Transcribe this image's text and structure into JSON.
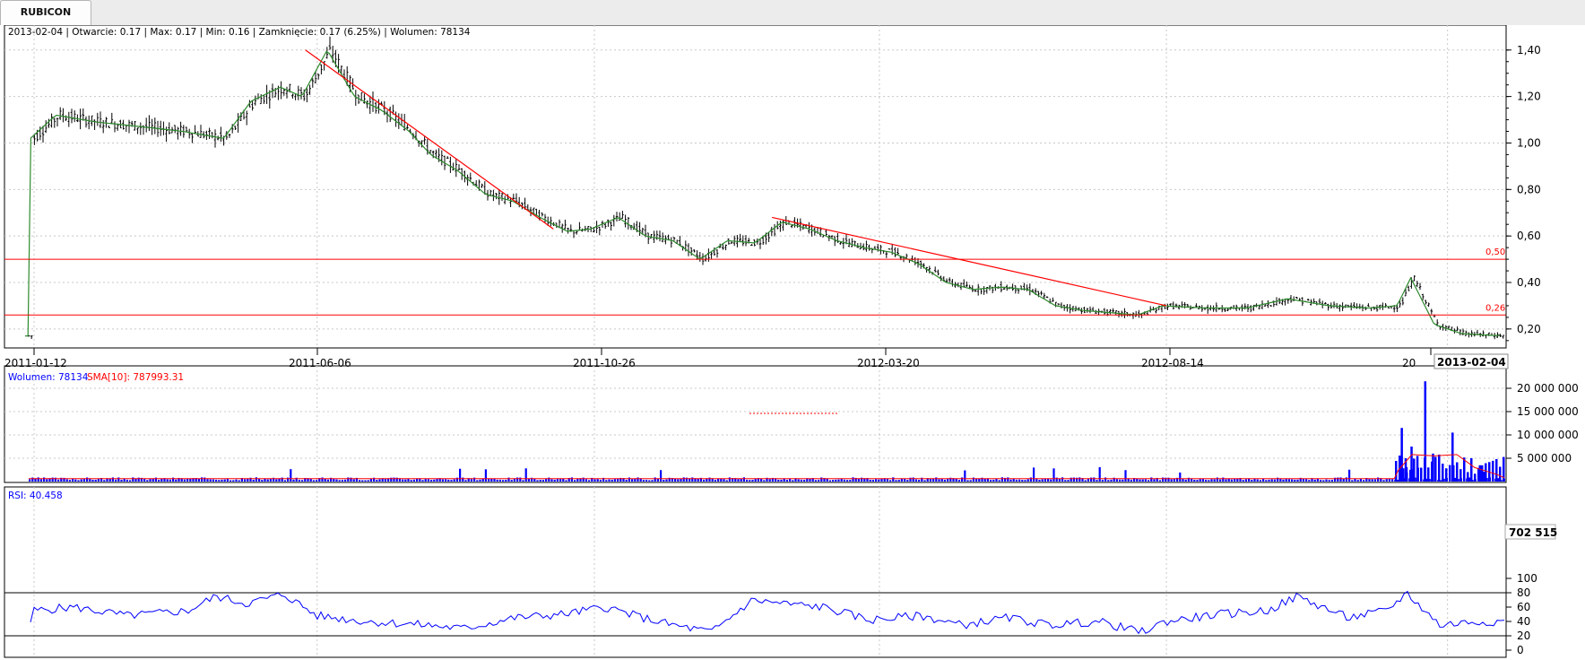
{
  "tab": {
    "label": "RUBICON"
  },
  "price_info": "2013-02-04 | Otwarcie: 0.17 | Max: 0.17 | Min: 0.16 | Zamknięcie: 0.17 (6.25%) | Wolumen: 78134",
  "volume_info": {
    "label": "Wolumen: 78134",
    "sma": "SMA[10]: 787993.31"
  },
  "rsi_info": "RSI: 40.458",
  "last_date_label": "2013-02-04",
  "last_volume_label": "702 515",
  "colors": {
    "price": "#000000",
    "sma": "#2d8a2d",
    "trendline": "#ff0000",
    "volume": "#0000ff",
    "volume_sma": "#ff0000",
    "rsi": "#0000ff"
  },
  "chart_data": [
    {
      "type": "line",
      "title": "",
      "x_tick_labels": [
        "2011-01-12",
        "2011-06-06",
        "2011-10-26",
        "2012-03-20",
        "2012-08-14",
        "20"
      ],
      "y_tick_labels": [
        "1,40",
        "1,20",
        "1,00",
        "0,80",
        "0,60",
        "0,40",
        "0,20"
      ],
      "y_ticks": [
        1.4,
        1.2,
        1.0,
        0.8,
        0.6,
        0.4,
        0.2
      ],
      "ylim": [
        0.13,
        1.43
      ],
      "x_range": [
        "2011-01-12",
        "2013-02-04"
      ],
      "grid": true,
      "series": [
        {
          "x": [
            "2011-01-12",
            "2011-01-25",
            "2011-02-15",
            "2011-03-10",
            "2011-03-31",
            "2011-04-21",
            "2011-05-05",
            "2011-05-20",
            "2011-05-31",
            "2011-06-13",
            "2011-06-27",
            "2011-07-11",
            "2011-07-25",
            "2011-08-05",
            "2011-08-19",
            "2011-09-02",
            "2011-09-16",
            "2011-09-30",
            "2011-10-14",
            "2011-10-26",
            "2011-11-09",
            "2011-11-23",
            "2011-12-07",
            "2011-12-21",
            "2012-01-04",
            "2012-01-18",
            "2012-02-01",
            "2012-02-15",
            "2012-02-29",
            "2012-03-14",
            "2012-03-28",
            "2012-04-11",
            "2012-04-25",
            "2012-05-09",
            "2012-05-23",
            "2012-06-06",
            "2012-06-20",
            "2012-07-04",
            "2012-07-18",
            "2012-08-01",
            "2012-08-14",
            "2012-09-05",
            "2012-09-26",
            "2012-10-17",
            "2012-11-07",
            "2012-11-28",
            "2012-12-12",
            "2012-12-19",
            "2012-12-31",
            "2013-01-14",
            "2013-02-04"
          ],
          "values": [
            1.02,
            1.12,
            1.09,
            1.07,
            1.05,
            1.02,
            1.18,
            1.24,
            1.2,
            1.4,
            1.2,
            1.14,
            1.05,
            0.95,
            0.88,
            0.78,
            0.75,
            0.68,
            0.62,
            0.63,
            0.68,
            0.6,
            0.58,
            0.5,
            0.58,
            0.57,
            0.66,
            0.63,
            0.58,
            0.55,
            0.53,
            0.48,
            0.4,
            0.37,
            0.38,
            0.37,
            0.3,
            0.28,
            0.27,
            0.26,
            0.3,
            0.29,
            0.29,
            0.33,
            0.3,
            0.29,
            0.3,
            0.42,
            0.22,
            0.18,
            0.17
          ]
        }
      ],
      "trendlines": [
        {
          "from": [
            "2011-05-31",
            1.4
          ],
          "to": [
            "2011-10-05",
            0.63
          ]
        },
        {
          "from": [
            "2012-01-25",
            0.68
          ],
          "to": [
            "2012-08-14",
            0.3
          ]
        }
      ],
      "horizontal_lines": [
        {
          "value": 0.5,
          "label": "0,50"
        },
        {
          "value": 0.26,
          "label": "0,26"
        }
      ]
    },
    {
      "type": "bar",
      "title": "Wolumen",
      "y_tick_labels": [
        "20 000 000",
        "15 000 000",
        "10 000 000",
        "5 000 000"
      ],
      "y_ticks": [
        20000000,
        15000000,
        10000000,
        5000000
      ],
      "ylim": [
        0,
        22500000
      ],
      "grid": true,
      "spikes": [
        {
          "x": "2012-12-12",
          "value": 11500000
        },
        {
          "x": "2012-12-14",
          "value": 5000000
        },
        {
          "x": "2012-12-17",
          "value": 7500000
        },
        {
          "x": "2012-12-20",
          "value": 5500000
        },
        {
          "x": "2012-12-24",
          "value": 21500000
        },
        {
          "x": "2012-12-28",
          "value": 6000000
        },
        {
          "x": "2013-01-07",
          "value": 10500000
        },
        {
          "x": "2013-01-21",
          "value": 3500000
        }
      ],
      "baseline_volume": 700000
    },
    {
      "type": "line",
      "title": "RSI",
      "y_tick_labels": [
        "100",
        "80",
        "60",
        "40",
        "20",
        "0"
      ],
      "y_ticks": [
        100,
        80,
        60,
        40,
        20,
        0
      ],
      "ylim": [
        0,
        100
      ],
      "levels": [
        80,
        20
      ],
      "series": [
        {
          "x": [
            "2011-01-12",
            "2011-02-01",
            "2011-03-01",
            "2011-04-01",
            "2011-04-15",
            "2011-05-01",
            "2011-05-20",
            "2011-06-06",
            "2011-07-01",
            "2011-08-01",
            "2011-08-20",
            "2011-09-15",
            "2011-10-10",
            "2011-11-01",
            "2011-11-20",
            "2011-12-05",
            "2011-12-25",
            "2012-01-15",
            "2012-01-30",
            "2012-02-20",
            "2012-03-15",
            "2012-04-10",
            "2012-05-01",
            "2012-05-25",
            "2012-06-15",
            "2012-07-10",
            "2012-08-01",
            "2012-08-14",
            "2012-09-10",
            "2012-10-05",
            "2012-10-20",
            "2012-11-15",
            "2012-12-05",
            "2012-12-15",
            "2013-01-01",
            "2013-01-20",
            "2013-02-04"
          ],
          "values": [
            55,
            60,
            48,
            55,
            75,
            65,
            78,
            48,
            40,
            35,
            30,
            45,
            50,
            60,
            45,
            35,
            25,
            70,
            65,
            60,
            42,
            48,
            35,
            45,
            35,
            40,
            25,
            40,
            50,
            55,
            75,
            45,
            55,
            80,
            35,
            40,
            40
          ]
        }
      ]
    }
  ]
}
